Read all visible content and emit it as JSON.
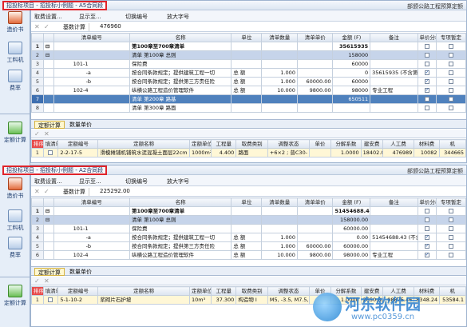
{
  "sidebar": {
    "items": [
      {
        "label": "造价书",
        "icon": "book-icon"
      },
      {
        "label": "工料机",
        "icon": "materials-icon"
      },
      {
        "label": "费率",
        "icon": "rate-icon"
      },
      {
        "label": "定额计算",
        "icon": "quota-icon"
      },
      {
        "label": "造价书",
        "icon": "book-icon"
      },
      {
        "label": "工料机",
        "icon": "materials-icon"
      },
      {
        "label": "费率",
        "icon": "rate-icon"
      },
      {
        "label": "定额计算",
        "icon": "quota-icon"
      }
    ]
  },
  "top": {
    "title": "招投标项目 - 招投标小例题 - A5合同段",
    "right": "部颁公路工程预算定额",
    "toolbar": [
      "取费设置...",
      "显示至...",
      "切换编号",
      "放大字号"
    ],
    "formula_label": "基数计算",
    "formula_value": "476960",
    "headers": [
      "清单编号",
      "名称",
      "单位",
      "清单数量",
      "清单单价",
      "金额 (F)",
      "备注",
      "单价分析",
      "专项暂定"
    ],
    "rows": [
      {
        "n": "1",
        "code": "",
        "name": "第100章至700章清单",
        "unit": "",
        "qty": "",
        "price": "",
        "amount": "35615935",
        "note": "",
        "style": "bold"
      },
      {
        "n": "2",
        "code": "",
        "name": "清单 第100章  总则",
        "unit": "",
        "qty": "",
        "price": "",
        "amount": "158000",
        "note": "",
        "style": "hl"
      },
      {
        "n": "3",
        "code": "101-1",
        "name": "保险费",
        "unit": "",
        "qty": "",
        "price": "",
        "amount": "60000",
        "note": "",
        "style": ""
      },
      {
        "n": "4",
        "code": "-a",
        "name": "按合同条款规定；提供建筑工程一切",
        "unit": "总 额",
        "qty": "1.000",
        "price": "",
        "amount": "0",
        "note": "35615935 (不含第1",
        "style": ""
      },
      {
        "n": "5",
        "code": "-b",
        "name": "按合同条款规定；提供第三方责任险",
        "unit": "总 额",
        "qty": "1.000",
        "price": "60000.00",
        "amount": "60000",
        "note": "",
        "style": ""
      },
      {
        "n": "6",
        "code": "102-4",
        "name": "纵横公路工程造价管理软件",
        "unit": "总 额",
        "qty": "10.000",
        "price": "9800.00",
        "amount": "98000",
        "note": "专业工程",
        "style": ""
      },
      {
        "n": "7",
        "code": "",
        "name": "清单 第200章  路基",
        "unit": "",
        "qty": "",
        "price": "",
        "amount": "650511",
        "note": "",
        "style": "blue"
      },
      {
        "n": "8",
        "code": "",
        "name": "清单 第300章  路面",
        "unit": "",
        "qty": "",
        "price": "",
        "amount": "",
        "note": "",
        "style": ""
      }
    ],
    "tabs": [
      "定额计算",
      "数量单价"
    ],
    "quota_headers": [
      "排序",
      "填清单量",
      "定额编号",
      "定额名称",
      "定额单位",
      "工程量",
      "取费类别",
      "调整状态",
      "单价",
      "分解系数",
      "建安费",
      "人工费",
      "材料费",
      "机"
    ],
    "quota_rows": [
      {
        "n": "1",
        "code": "2-2-17-5",
        "name": "滑模摊铺机铺筑水泥混凝土面层22cm",
        "unit": "1000m²",
        "qty": "4.400",
        "cat": "路面",
        "adj": "+6×2 ; 普C30-",
        "price": "",
        "coef": "1.0000",
        "jaf": "18402.05",
        "jaf2": "476989",
        "rgf": "10082",
        "clf": "344665"
      }
    ]
  },
  "bottom": {
    "title": "招投标项目 - 招投标小例题 - A2合同段",
    "right": "部颁公路工程预算定额",
    "toolbar": [
      "取费设置...",
      "显示至...",
      "切换编号",
      "放大字号"
    ],
    "formula_label": "基数计算",
    "formula_value": "225292.00",
    "headers": [
      "清单编号",
      "名称",
      "单位",
      "清单数量",
      "清单单价",
      "金额 (F)",
      "备注",
      "单价分析",
      "专项暂定"
    ],
    "rows": [
      {
        "n": "1",
        "code": "",
        "name": "第100章至700章清单",
        "unit": "",
        "qty": "",
        "price": "",
        "amount": "51454688.43",
        "note": "",
        "style": "bold"
      },
      {
        "n": "2",
        "code": "",
        "name": "清单 第100章  总则",
        "unit": "",
        "qty": "",
        "price": "",
        "amount": "158000.00",
        "note": "",
        "style": "hl"
      },
      {
        "n": "3",
        "code": "101-1",
        "name": "保险费",
        "unit": "",
        "qty": "",
        "price": "",
        "amount": "60000.00",
        "note": "",
        "style": ""
      },
      {
        "n": "4",
        "code": "-a",
        "name": "按合同条款规定；提供建筑工程一切",
        "unit": "总 额",
        "qty": "1.000",
        "price": "",
        "amount": "0.00",
        "note": "51454688.43 (不含第1",
        "style": ""
      },
      {
        "n": "5",
        "code": "-b",
        "name": "按合同条款规定；提供第三方责任险",
        "unit": "总 额",
        "qty": "1.000",
        "price": "60000.00",
        "amount": "60000.00",
        "note": "",
        "style": ""
      },
      {
        "n": "6",
        "code": "102-4",
        "name": "纵横公路工程造价管理软件",
        "unit": "总 额",
        "qty": "10.000",
        "price": "9800.00",
        "amount": "98000.00",
        "note": "专业工程",
        "style": ""
      }
    ],
    "tabs": [
      "定额计算",
      "数量单价"
    ],
    "quota_headers": [
      "排序",
      "填清单量",
      "定额编号",
      "定额名称",
      "定额单位",
      "工程量",
      "取费类别",
      "调整状态",
      "单价",
      "分解系数",
      "建安费",
      "人工费",
      "材料费",
      "机"
    ],
    "quota_rows": [
      {
        "n": "1",
        "code": "5-1-10-2",
        "name": "浆砌片石护坡",
        "unit": "10m³",
        "qty": "37.300",
        "cat": "构造物 I",
        "adj": "M5, -3.5, M7.5, +",
        "price": "",
        "coef": "1.0000",
        "jaf": "2650.82",
        "jaf2": "98875.46",
        "rgf": "8348.24",
        "clf": "53584.1"
      }
    ]
  },
  "watermark": {
    "line1": "河东软件园",
    "line2": "www.pc0359.cn"
  },
  "colors": {
    "title_frame": "#e0242a",
    "selected_row": "#4f81bd",
    "header_bg": "#dbe4f0"
  }
}
